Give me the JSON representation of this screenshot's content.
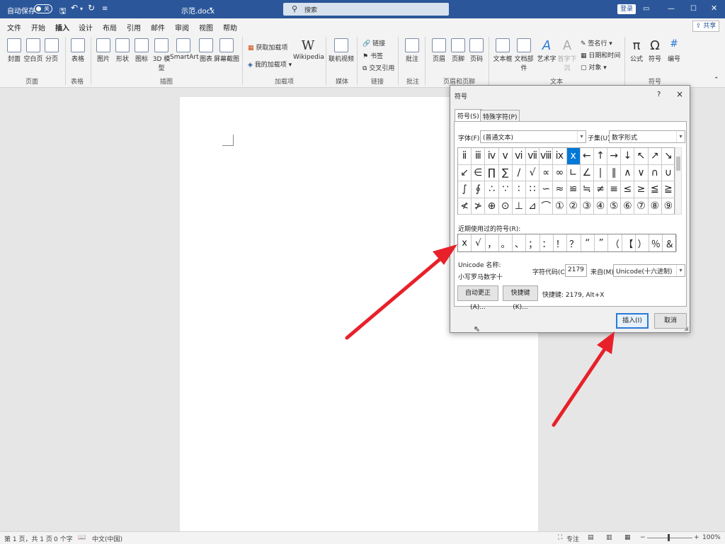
{
  "title_bar": {
    "autosave_label": "自动保存",
    "autosave_state": "关",
    "doc_name": "示范.docx",
    "search_placeholder": "搜索",
    "login_label": "登录",
    "background_color": "#2b579a"
  },
  "menu": {
    "items": [
      "文件",
      "开始",
      "插入",
      "设计",
      "布局",
      "引用",
      "邮件",
      "审阅",
      "视图",
      "帮助"
    ],
    "active": "插入",
    "share_label": "共享"
  },
  "ribbon": {
    "pages": {
      "items": [
        "封面",
        "空白页",
        "分页"
      ],
      "group": "页面"
    },
    "table": {
      "items": [
        "表格"
      ],
      "group": "表格"
    },
    "illustrations": {
      "items": [
        "图片",
        "形状",
        "图标",
        "3D 模型",
        "SmartArt",
        "图表",
        "屏幕截图"
      ],
      "group": "插图"
    },
    "addins": {
      "items": [
        "获取加载项",
        "我的加载项",
        "Wikipedia"
      ],
      "group": "加载项"
    },
    "media": {
      "items": [
        "联机视频"
      ],
      "group": "媒体"
    },
    "links": {
      "items": [
        "链接",
        "书签",
        "交叉引用"
      ],
      "group": "链接"
    },
    "comments": {
      "items": [
        "批注"
      ],
      "group": "批注"
    },
    "header_footer": {
      "items": [
        "页眉",
        "页脚",
        "页码"
      ],
      "group": "页眉和页脚"
    },
    "text": {
      "items": [
        "文本框",
        "文档部件",
        "艺术字",
        "首字下沉",
        "签名行",
        "日期和时间",
        "对象"
      ],
      "group": "文本"
    },
    "symbols": {
      "items": [
        "公式",
        "符号",
        "编号"
      ],
      "group": "符号"
    }
  },
  "status_bar": {
    "page": "第 1 页，共 1 页",
    "words": "0 个字",
    "language": "中文(中国)",
    "focus": "专注",
    "zoom": "100%"
  },
  "dialog": {
    "title": "符号",
    "help": "?",
    "close": "×",
    "tabs": [
      "符号(S)",
      "特殊字符(P)"
    ],
    "font_label": "字体(F):",
    "font_value": "(普通文本)",
    "subset_label": "子集(U):",
    "subset_value": "数字形式",
    "symbol_grid": [
      "ⅱ",
      "ⅲ",
      "ⅳ",
      "ⅴ",
      "ⅵ",
      "ⅶ",
      "ⅷ",
      "ⅸ",
      "ⅹ",
      "←",
      "↑",
      "→",
      "↓",
      "↖",
      "↗",
      "↘",
      "↙",
      "∈",
      "∏",
      "∑",
      "∕",
      "√",
      "∝",
      "∞",
      "∟",
      "∠",
      "∣",
      "∥",
      "∧",
      "∨",
      "∩",
      "∪",
      "∫",
      "∮",
      "∴",
      "∵",
      "∶",
      "∷",
      "∽",
      "≈",
      "≌",
      "≒",
      "≠",
      "≡",
      "≤",
      "≥",
      "≦",
      "≧",
      "≮",
      "≯",
      "⊕",
      "⊙",
      "⊥",
      "⊿",
      "⌒",
      "①",
      "②",
      "③",
      "④",
      "⑤",
      "⑥",
      "⑦",
      "⑧",
      "⑨"
    ],
    "selected_symbol": "ⅹ",
    "recent_label": "近期使用过的符号(R):",
    "recent_symbols": [
      "ⅹ",
      "√",
      "，",
      "。",
      "、",
      "；",
      "：",
      "！",
      "？",
      "“",
      "”",
      "（",
      "【",
      "）",
      "％",
      "＆"
    ],
    "unicode_name_label": "Unicode 名称:",
    "unicode_name_value": "小写罗马数字十",
    "char_code_label": "字符代码(C):",
    "char_code_value": "2179",
    "from_label": "来自(M):",
    "from_value": "Unicode(十六进制)",
    "autocorrect_button": "自动更正(A)...",
    "shortcut_button": "快捷键(K)...",
    "shortcut_text": "快捷键: 2179, Alt+X",
    "insert_button": "插入(I)",
    "cancel_button": "取消"
  },
  "annotation_color": "#e8202a"
}
